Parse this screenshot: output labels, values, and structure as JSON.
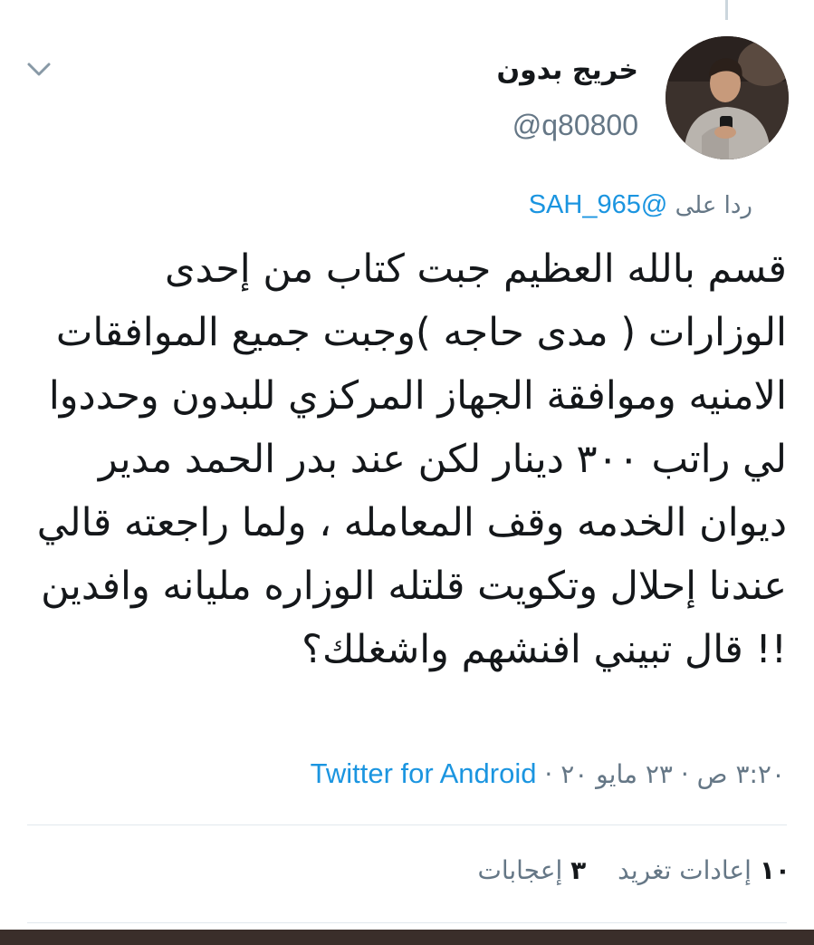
{
  "tweet": {
    "author": {
      "display_name": "خريج بدون",
      "handle": "@q80800"
    },
    "reply": {
      "prefix": "ردا على",
      "mention": "@SAH_965"
    },
    "text": "قسم بالله العظيم جبت كتاب من إحدى الوزارات ( مدى حاجه )وجبت جميع الموافقات الامنيه وموافقة الجهاز المركزي للبدون وحددوا لي راتب ٣٠٠ دينار لكن عند بدر الحمد مدير ديوان الخدمه وقف المعامله ، ولما راجعته قالي عندنا إحلال وتكويت قلتله الوزاره مليانه وافدين !! قال تبيني افنشهم واشغلك؟",
    "time": "٣:٢٠ ص",
    "date": "٢٣ مايو ٢٠",
    "source": "Twitter for Android",
    "separator": "·",
    "stats": {
      "retweets_count": "١٠",
      "retweets_label": "إعادات تغريد",
      "likes_count": "٣",
      "likes_label": "إعجابات"
    }
  },
  "icons": {
    "chevron": "chevron-down-icon",
    "avatar": "profile-photo"
  },
  "colors": {
    "link": "#1b95e0",
    "secondary_text": "#657786",
    "primary_text": "#14171a",
    "divider": "#e1e8ed"
  }
}
